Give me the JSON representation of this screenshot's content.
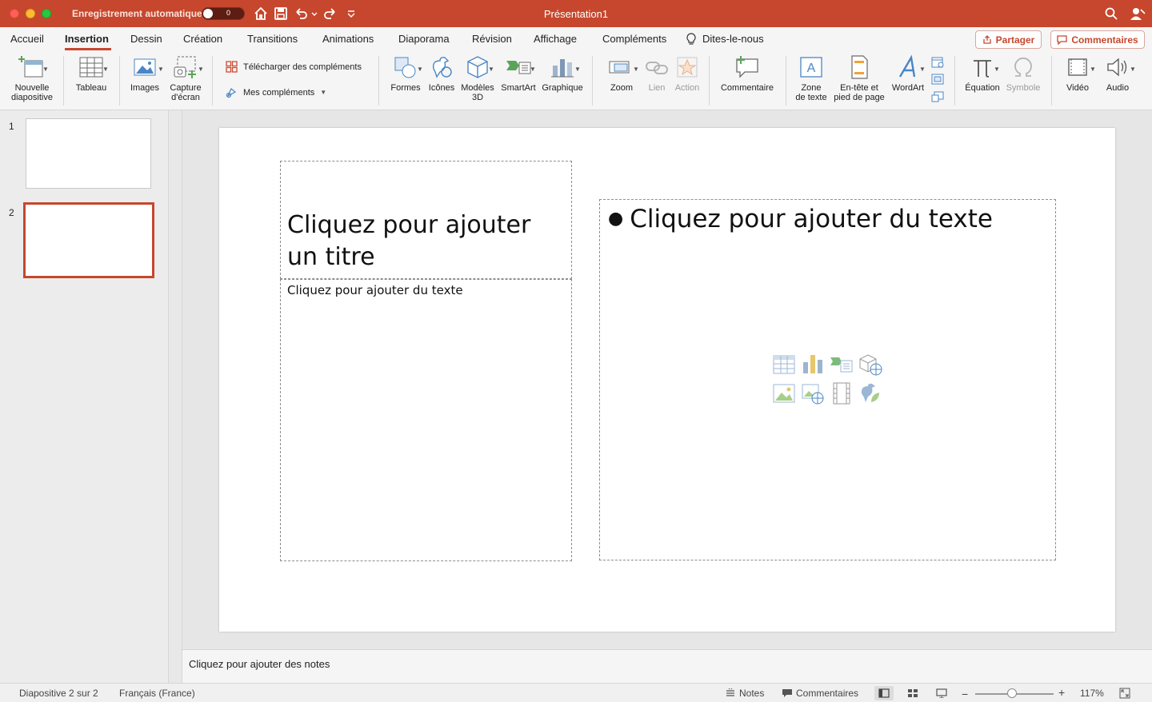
{
  "titlebar": {
    "autosave_label": "Enregistrement automatique",
    "autosave_state": "0",
    "title": "Présentation1",
    "color": "#c6472d"
  },
  "tabs": [
    "Accueil",
    "Insertion",
    "Dessin",
    "Création",
    "Transitions",
    "Animations",
    "Diaporama",
    "Révision",
    "Affichage",
    "Compléments",
    "Dites-le-nous"
  ],
  "active_tab": "Insertion",
  "header_buttons": {
    "share": "Partager",
    "comments": "Commentaires"
  },
  "ribbon": {
    "new_slide": "Nouvelle\ndiapositive",
    "table": "Tableau",
    "images": "Images",
    "screenshot": "Capture\nd'écran",
    "get_addins": "Télécharger des compléments",
    "my_addins": "Mes compléments",
    "shapes": "Formes",
    "icons": "Icônes",
    "models3d": "Modèles\n3D",
    "smartart": "SmartArt",
    "chart": "Graphique",
    "zoom": "Zoom",
    "link": "Lien",
    "action": "Action",
    "comment": "Commentaire",
    "textbox": "Zone\nde texte",
    "header_footer": "En-tête et\npied de page",
    "wordart": "WordArt",
    "equation": "Équation",
    "symbol": "Symbole",
    "video": "Vidéo",
    "audio": "Audio"
  },
  "slides_panel": {
    "numbers": [
      "1",
      "2"
    ],
    "selected": "2"
  },
  "slide": {
    "title_placeholder": "Cliquez pour ajouter un titre",
    "text_placeholder": "Cliquez pour ajouter du texte",
    "content_placeholder": "Cliquez pour ajouter du texte",
    "insert_icons": [
      "table-icon",
      "chart-icon",
      "smartart-icon",
      "3d-model-icon",
      "picture-icon",
      "online-picture-icon",
      "video-icon",
      "icons-icon"
    ]
  },
  "notes": {
    "placeholder": "Cliquez pour ajouter des notes"
  },
  "statusbar": {
    "slide_position": "Diapositive 2 sur 2",
    "language": "Français (France)",
    "notes": "Notes",
    "comments": "Commentaires",
    "zoom_level": "117%",
    "zoom_fraction": 0.47
  }
}
